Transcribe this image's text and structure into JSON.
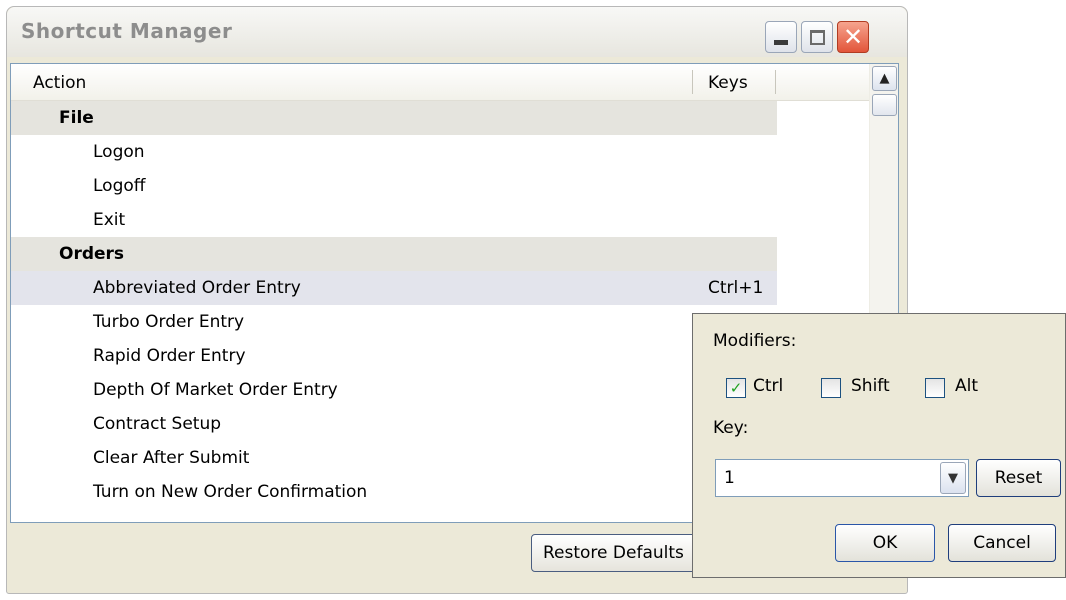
{
  "window": {
    "title": "Shortcut Manager",
    "close_glyph": "✕"
  },
  "list": {
    "columns": {
      "action": "Action",
      "keys": "Keys"
    },
    "rows": [
      {
        "type": "category",
        "label": "File",
        "keys": ""
      },
      {
        "type": "item",
        "label": "Logon",
        "keys": ""
      },
      {
        "type": "item",
        "label": "Logoff",
        "keys": ""
      },
      {
        "type": "item",
        "label": "Exit",
        "keys": ""
      },
      {
        "type": "category",
        "label": "Orders",
        "keys": ""
      },
      {
        "type": "item",
        "label": "Abbreviated Order Entry",
        "keys": "Ctrl+1",
        "selected": true
      },
      {
        "type": "item",
        "label": "Turbo Order Entry",
        "keys": ""
      },
      {
        "type": "item",
        "label": "Rapid Order Entry",
        "keys": ""
      },
      {
        "type": "item",
        "label": "Depth Of Market Order Entry",
        "keys": ""
      },
      {
        "type": "item",
        "label": "Contract Setup",
        "keys": ""
      },
      {
        "type": "item",
        "label": "Clear After Submit",
        "keys": ""
      },
      {
        "type": "item",
        "label": "Turn on New Order Confirmation",
        "keys": ""
      }
    ]
  },
  "footer": {
    "restore_label": "Restore Defaults"
  },
  "popup": {
    "modifiers_label": "Modifiers:",
    "ctrl": {
      "label": "Ctrl",
      "checked": true,
      "mark": "✓"
    },
    "shift": {
      "label": "Shift",
      "checked": false,
      "mark": ""
    },
    "alt": {
      "label": "Alt",
      "checked": false,
      "mark": ""
    },
    "key_label": "Key:",
    "key_value": "1",
    "reset_label": "Reset",
    "ok_label": "OK",
    "cancel_label": "Cancel"
  },
  "icons": {
    "minimize": "minimize-icon",
    "maximize": "maximize-icon",
    "close": "close-icon",
    "scroll_up": "chevron-up-icon",
    "dropdown": "chevron-down-icon",
    "checkbox_mark": "checkmark-icon"
  },
  "colors": {
    "selected_row": "#e3e4ec",
    "category_row": "#e5e4de",
    "checkmark": "#21a121",
    "close_button": "#e2553a"
  }
}
